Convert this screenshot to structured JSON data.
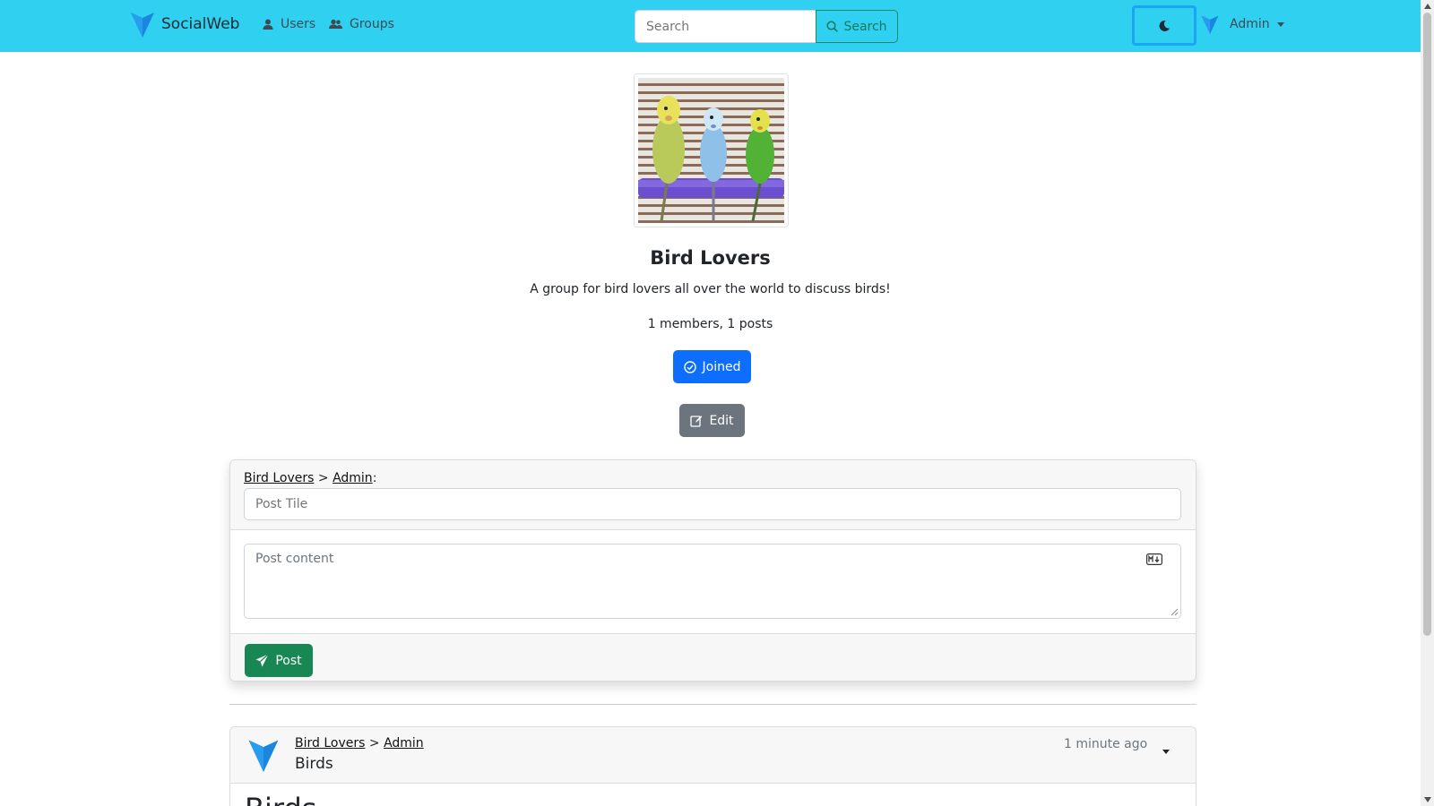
{
  "navbar": {
    "brand": "SocialWeb",
    "nav_users": "Users",
    "nav_groups": "Groups",
    "search_placeholder": "Search",
    "search_button": "Search",
    "user_name": "Admin",
    "brand_color": "#2fd0f0"
  },
  "group": {
    "name": "Bird Lovers",
    "description": "A group for bird lovers all over the world to discuss birds!",
    "stats": "1 members, 1 posts",
    "joined_label": "Joined",
    "edit_label": "Edit"
  },
  "composer": {
    "crumb_group": "Bird Lovers",
    "crumb_sep": " > ",
    "crumb_user": "Admin",
    "crumb_colon": ":",
    "title_placeholder": "Post Tile",
    "content_placeholder": "Post content",
    "post_label": "Post"
  },
  "post": {
    "crumb_group": "Bird Lovers",
    "crumb_sep": " > ",
    "crumb_user": "Admin",
    "title": "Birds",
    "time": "1 minute ago",
    "body_heading": "Birds"
  },
  "colors": {
    "primary": "#0d6efd",
    "secondary": "#6c757d",
    "success": "#198754",
    "search_outline": "#15785a"
  }
}
